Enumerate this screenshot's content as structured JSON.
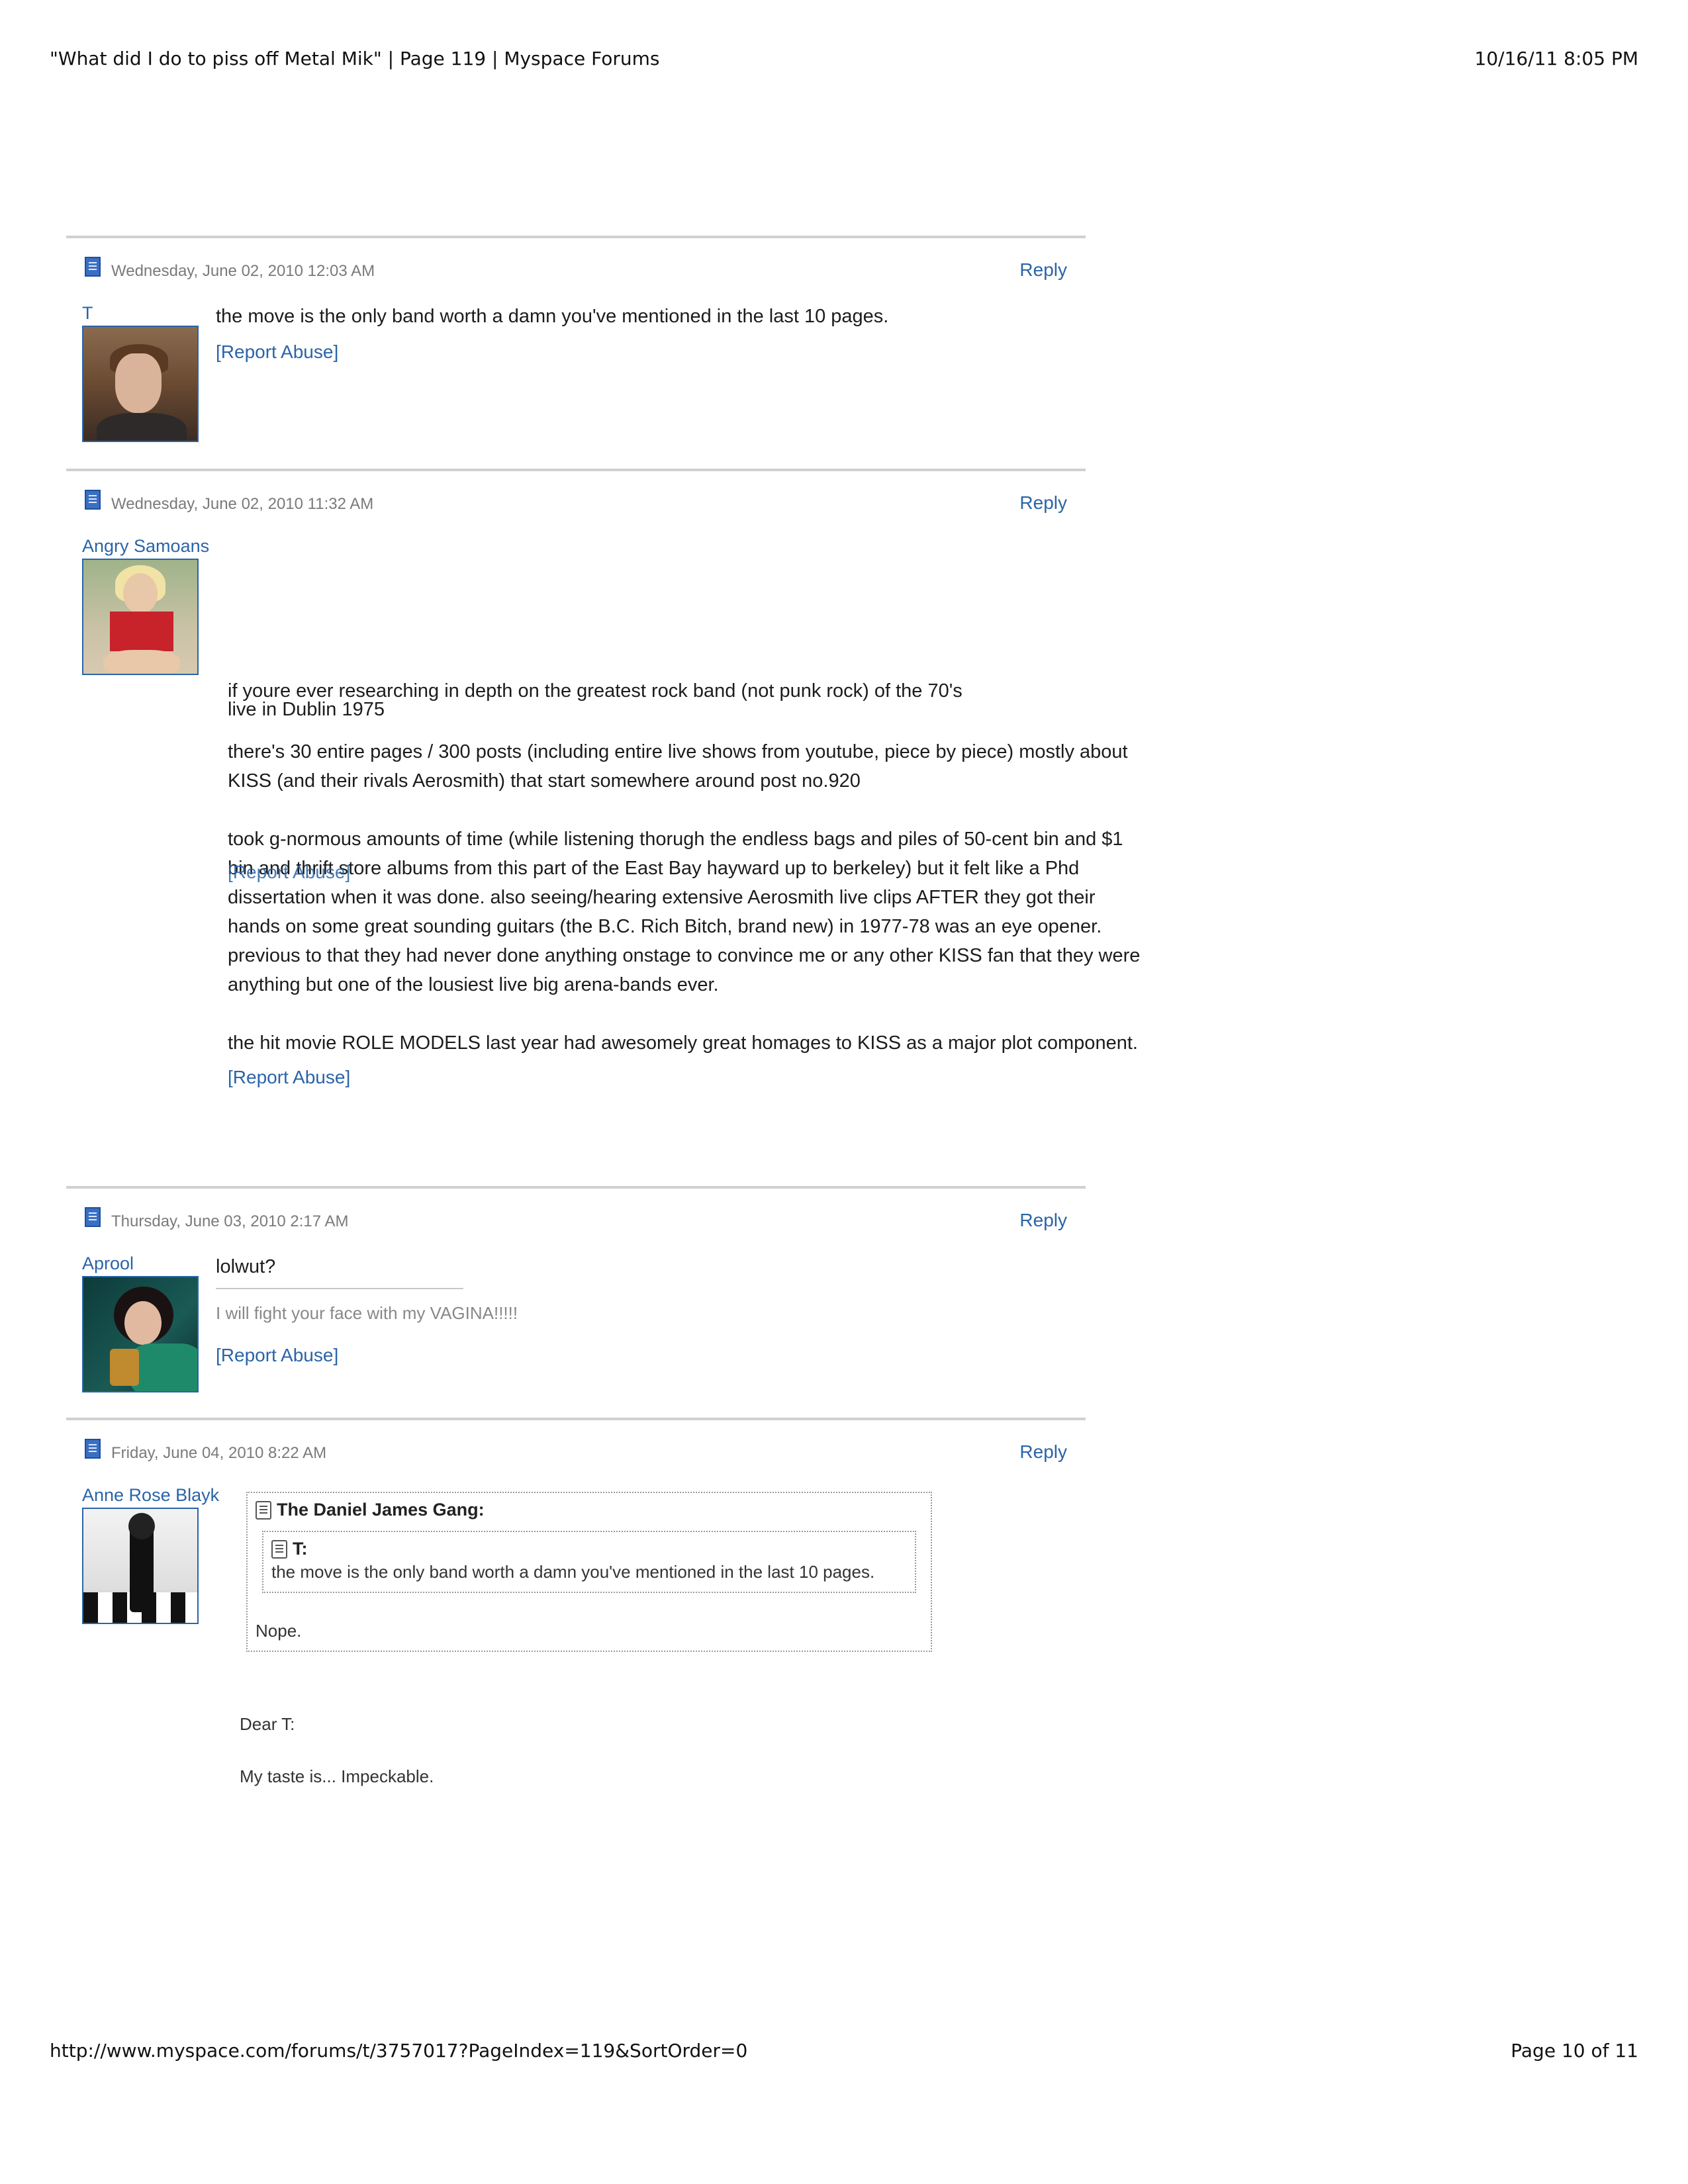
{
  "header": {
    "title": "\"What did I do to piss off Metal Mik\" | Page 119 | Myspace Forums",
    "datetime": "10/16/11 8:05 PM"
  },
  "footer": {
    "url": "http://www.myspace.com/forums/t/3757017?PageIndex=119&SortOrder=0",
    "page": "Page 10 of 11"
  },
  "reply_label": "Reply",
  "report_label": "Report Abuse",
  "posts": [
    {
      "date": "Wednesday, June 02, 2010 12:03 AM",
      "author": "T",
      "text": "the move is the only band worth a damn you've mentioned in the last 10 pages."
    },
    {
      "date": "Wednesday, June 02, 2010 11:32 AM",
      "author": "Angry Samoans",
      "line1": "if youre ever researching in depth on the greatest rock band (not punk rock) of the 70's",
      "line2": "live in Dublin 1975",
      "para1": "there's 30 entire pages / 300 posts (including entire live shows from youtube, piece by piece) mostly about KISS (and their rivals Aerosmith) that start somewhere around post no.920",
      "para2": "took g-normous amounts of time (while listening thorugh the endless bags and piles of 50-cent bin and $1 bin and thrift store albums from this part of the East Bay hayward up to berkeley) but it felt like a Phd dissertation when it was done. also seeing/hearing extensive Aerosmith live clips AFTER they got their hands on some great sounding guitars (the B.C. Rich Bitch, brand new) in 1977-78 was an eye opener. previous to that they had never done anything onstage to convince me or any other KISS fan that they were anything but one of the lousiest live big arena-bands ever.",
      "para3": "the hit movie ROLE MODELS last year had awesomely great homages to KISS as a major plot component."
    },
    {
      "date": "Thursday, June 03, 2010 2:17 AM",
      "author": "Aprool",
      "text": "lolwut?",
      "signature": "I will fight your face with my VAGINA!!!!!"
    },
    {
      "date": "Friday, June 04, 2010 8:22 AM",
      "author": "Anne Rose Blayk",
      "outer_quote_author": "The Daniel James Gang:",
      "inner_quote_author": "T:",
      "inner_quote_text": "the move is the only band worth a damn you've mentioned in the last 10 pages.",
      "outer_quote_text": "Nope.",
      "line1": "Dear T:",
      "line2": "My taste is... Impeckable."
    }
  ]
}
